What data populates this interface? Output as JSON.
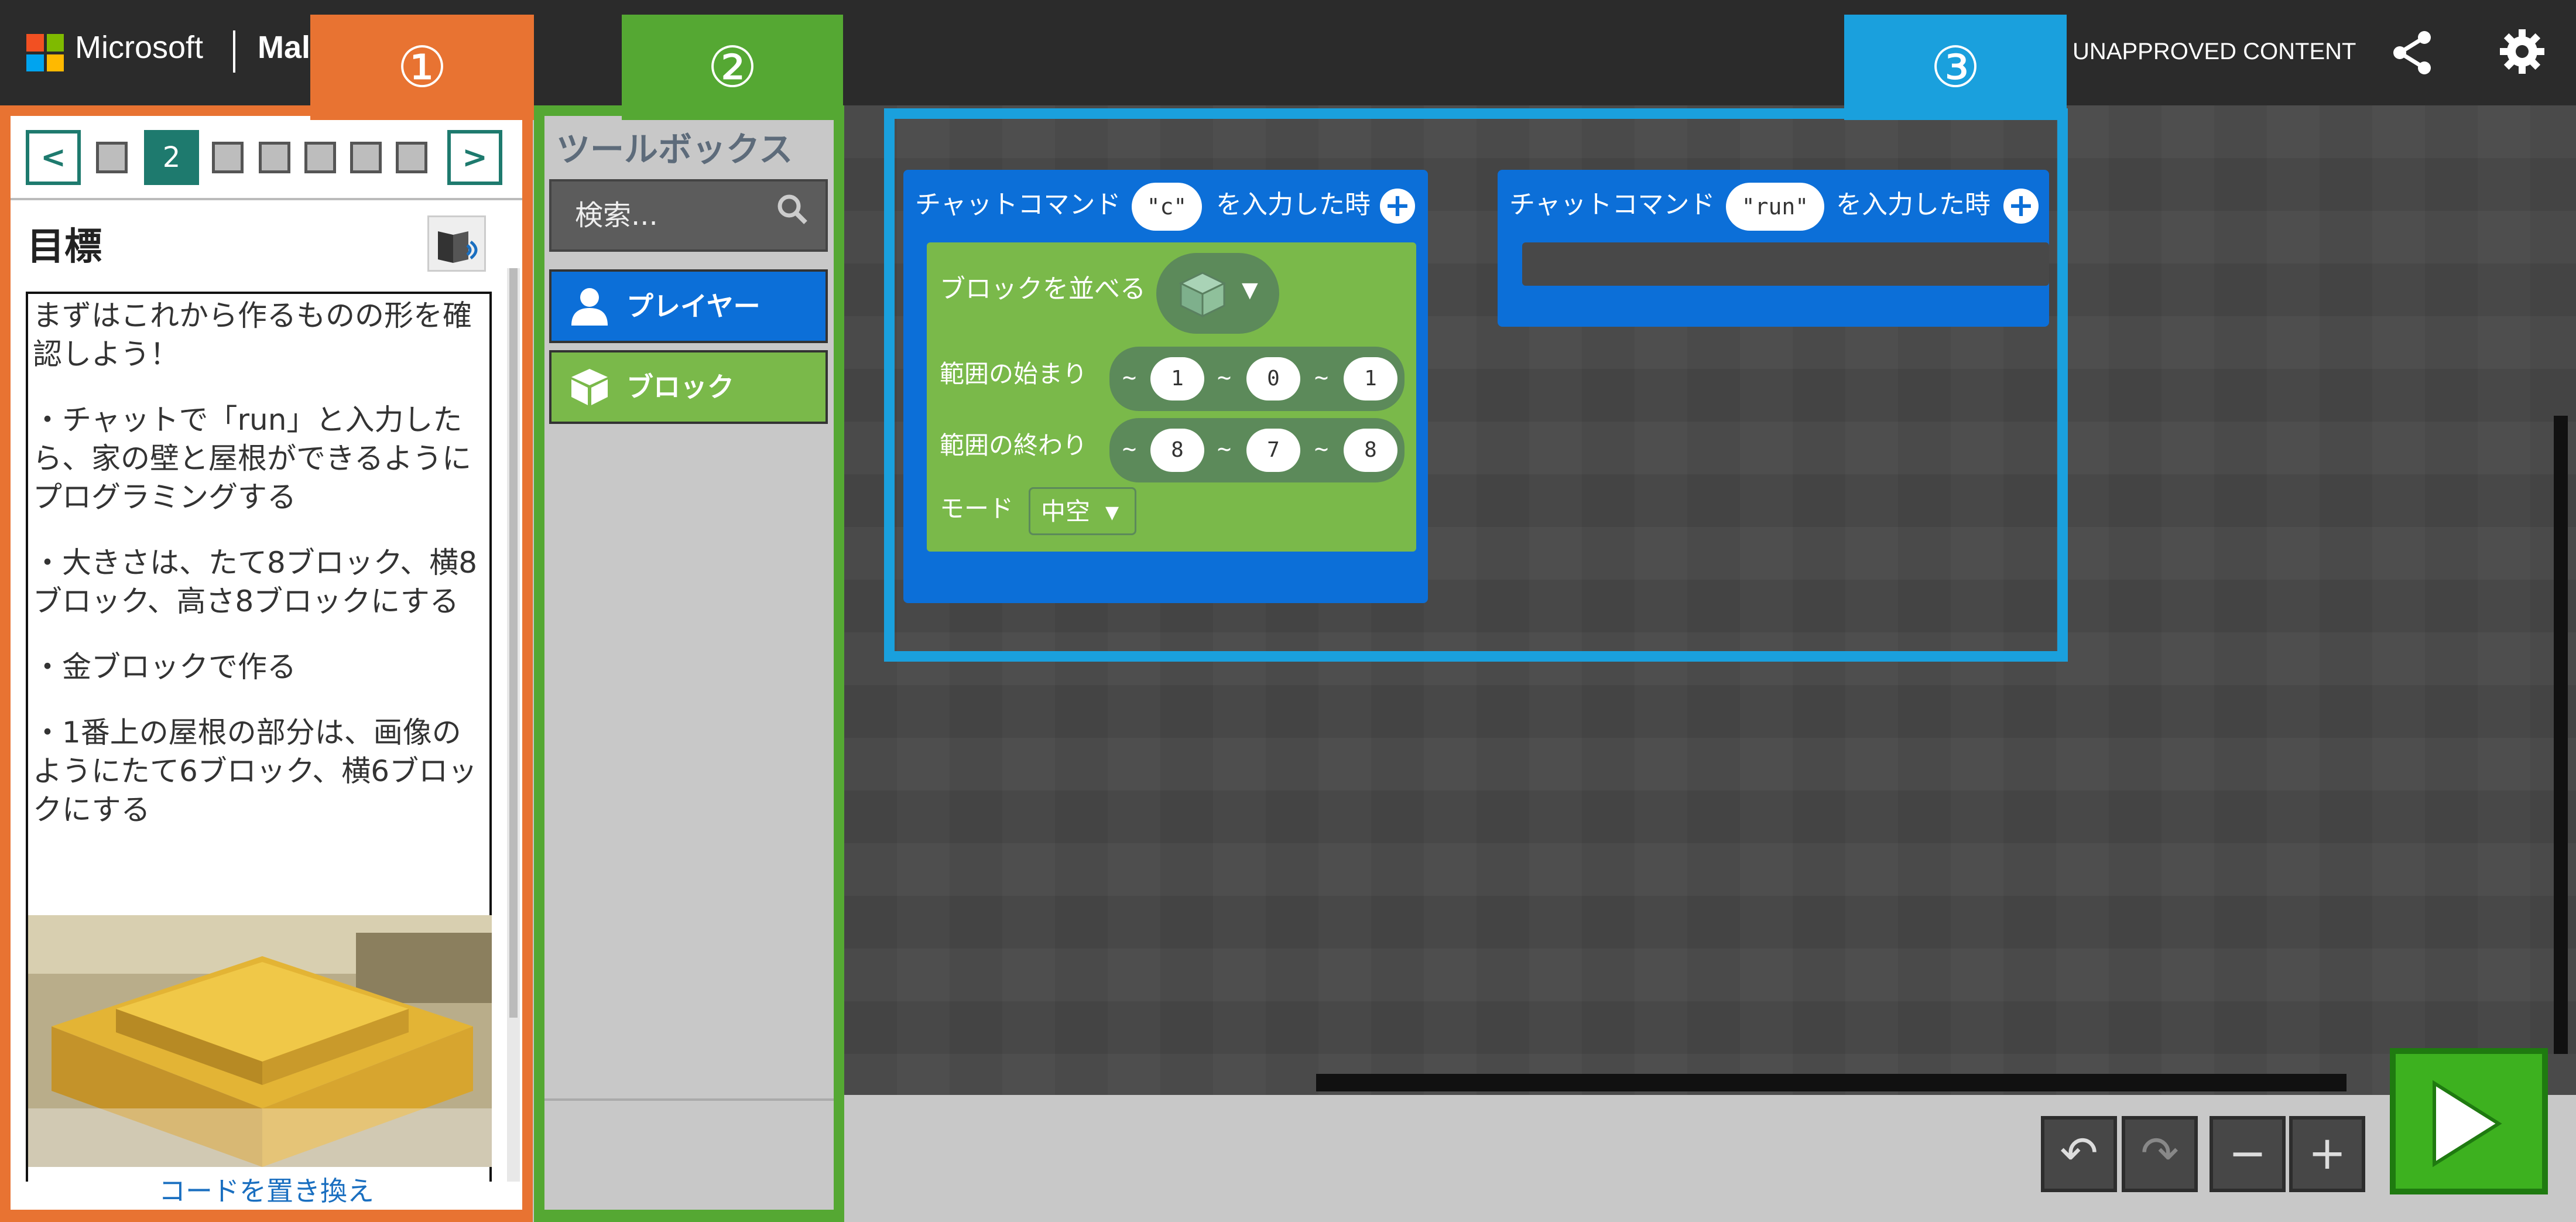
{
  "header": {
    "brand": "Microsoft",
    "app_name_partial": "Mal",
    "unapproved_label": "UNAPPROVED CONTENT",
    "share_icon": "share-icon",
    "settings_icon": "gear-icon"
  },
  "callouts": [
    "①",
    "②",
    "③"
  ],
  "tutorial": {
    "steps": {
      "current": "2",
      "prev_label": "<",
      "next_label": ">"
    },
    "goal_title": "目標",
    "paragraphs": [
      "まずはこれから作るものの形を確認しよう！",
      "・チャットで「run」と入力したら、家の壁と屋根ができるようにプログラミングする",
      "・大きさは、たて8ブロック、横8ブロック、高さ8ブロックにする",
      "・金ブロックで作る",
      "・1番上の屋根の部分は、画像のようにたて6ブロック、横6ブロックにする"
    ],
    "replace_code_label": "コードを置き換え"
  },
  "toolbox": {
    "title": "ツールボックス",
    "search_placeholder": "検索...",
    "categories": [
      {
        "label": "プレイヤー",
        "color": "#0c6fd8",
        "icon": "player-icon"
      },
      {
        "label": "ブロック",
        "color": "#7ab94a",
        "icon": "block-cube-icon"
      }
    ]
  },
  "workspace": {
    "block1": {
      "prefix": "チャットコマンド",
      "command": "c",
      "suffix": "を入力した時",
      "fill": {
        "label": "ブロックを並べる",
        "from_label": "範囲の始まり",
        "from": [
          "1",
          "0",
          "1"
        ],
        "to_label": "範囲の終わり",
        "to": [
          "8",
          "7",
          "8"
        ],
        "mode_label": "モード",
        "mode_value": "中空"
      }
    },
    "block2": {
      "prefix": "チャットコマンド",
      "command": "run",
      "suffix": "を入力した時"
    },
    "tilde": "~"
  },
  "controls": {
    "undo_icon": "undo-icon",
    "redo_icon": "redo-icon",
    "zoom_out_label": "−",
    "zoom_in_label": "+",
    "run_icon": "play-icon"
  }
}
